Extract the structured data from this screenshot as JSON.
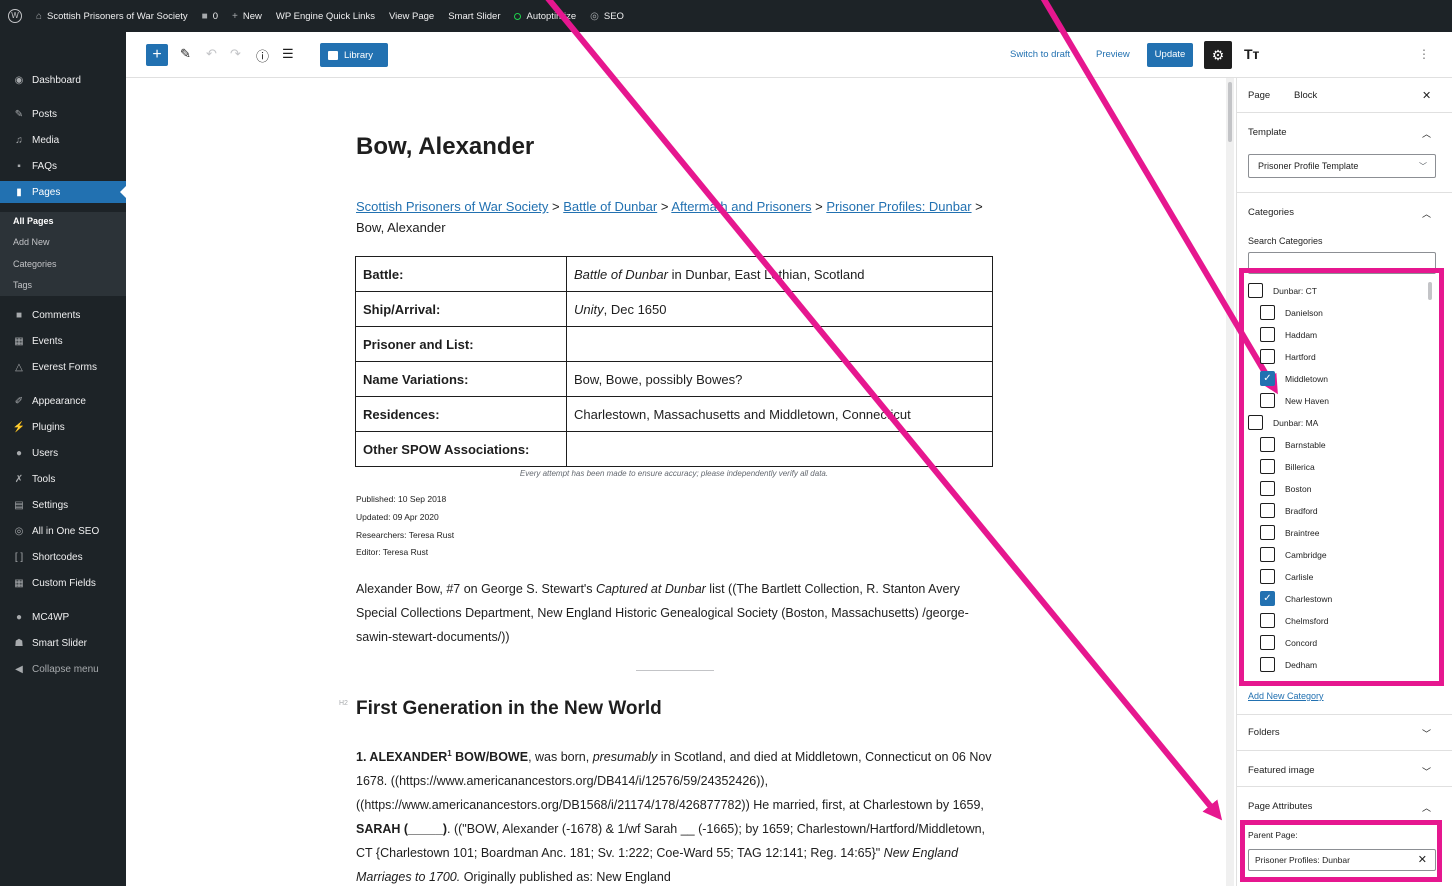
{
  "admin_bar": {
    "site_name": "Scottish Prisoners of War Society",
    "comments_count": "0",
    "new_label": "New",
    "quick_links": "WP Engine Quick Links",
    "view_page": "View Page",
    "smart_slider": "Smart Slider",
    "autoptimize": "Autoptimize",
    "seo": "SEO"
  },
  "sidebar": {
    "items": [
      {
        "label": "Dashboard",
        "icon": "dashboard-icon"
      },
      {
        "label": "Posts",
        "icon": "pin-icon"
      },
      {
        "label": "Media",
        "icon": "media-icon"
      },
      {
        "label": "FAQs",
        "icon": "faq-icon"
      },
      {
        "label": "Pages",
        "icon": "pages-icon"
      },
      {
        "label": "Comments",
        "icon": "comment-icon"
      },
      {
        "label": "Events",
        "icon": "calendar-icon"
      },
      {
        "label": "Everest Forms",
        "icon": "forms-icon"
      },
      {
        "label": "Appearance",
        "icon": "brush-icon"
      },
      {
        "label": "Plugins",
        "icon": "plugin-icon"
      },
      {
        "label": "Users",
        "icon": "users-icon"
      },
      {
        "label": "Tools",
        "icon": "wrench-icon"
      },
      {
        "label": "Settings",
        "icon": "settings-icon"
      },
      {
        "label": "All in One SEO",
        "icon": "seo-icon"
      },
      {
        "label": "Shortcodes",
        "icon": "brackets-icon"
      },
      {
        "label": "Custom Fields",
        "icon": "grid-icon"
      },
      {
        "label": "MC4WP",
        "icon": "mail-icon"
      },
      {
        "label": "Smart Slider",
        "icon": "slider-icon"
      },
      {
        "label": "Collapse menu",
        "icon": "collapse-icon"
      }
    ],
    "submenu": [
      "All Pages",
      "Add New",
      "Categories",
      "Tags"
    ]
  },
  "toolbar": {
    "library": "Library",
    "switch_to_draft": "Switch to draft",
    "preview": "Preview",
    "update": "Update"
  },
  "page": {
    "title": "Bow, Alexander",
    "breadcrumb": {
      "links": [
        "Scottish Prisoners of War Society",
        "Battle of Dunbar",
        "Aftermath and Prisoners",
        "Prisoner Profiles: Dunbar"
      ],
      "separator": " > ",
      "current": "Bow, Alexander"
    },
    "table": [
      {
        "label": "Battle:",
        "value_em": "Battle of Dunbar",
        "value": " in Dunbar, East Lothian, Scotland"
      },
      {
        "label": "Ship/Arrival:",
        "value_em": "Unity",
        "value": ", Dec 1650"
      },
      {
        "label": "Prisoner and List:",
        "value_em": "",
        "value": ""
      },
      {
        "label": "Name Variations:",
        "value_em": "",
        "value": "Bow, Bowe, possibly Bowes?"
      },
      {
        "label": "Residences:",
        "value_em": "",
        "value": "Charlestown, Massachusetts and Middletown, Connecticut"
      },
      {
        "label": "Other SPOW Associations:",
        "value_em": "",
        "value": ""
      }
    ],
    "caption": "Every attempt has been made to ensure accuracy; please independently verify all data.",
    "published": "Published: 10 Sep 2018",
    "updated": "Updated: 09 Apr 2020",
    "researchers": "Researchers: Teresa Rust",
    "editor": "Editor: Teresa Rust",
    "intro": {
      "before": "Alexander Bow, #7 on George S. Stewart's ",
      "em": "Captured at Dunbar",
      "after": " list ((The Bartlett Collection, R. Stanton Avery Special Collections Department, New England Historic Genealogical Society (Boston, Massachusetts) /george-sawin-stewart-documents/))"
    },
    "h2_tag": "H2",
    "heading": "First Generation in the New World",
    "gen": {
      "name": "1. ALEXANDER",
      "sup": "1",
      "name2": " BOW/BOWE",
      "t1": ", was born, ",
      "em1": "presumably",
      "t2": " in Scotland, and died at Middletown, Connecticut on 06 Nov 1678.  ((https://www.americanancestors.org/DB414/i/12576/59/24352426)), ((https://www.americanancestors.org/DB1568/i/21174/178/426877782)) He married, first, at Charlestown by 1659, ",
      "name3": "SARAH (_____)",
      "t3": ". ((\"BOW, Alexander (-1678) & 1/wf Sarah __ (-1665); by 1659; Charlestown/Hartford/Middletown, CT {Charlestown 101; Boardman Anc. 181; Sv. 1:222; Coe-Ward 55; TAG 12:141; Reg. 14:65}\" ",
      "em2": "New England Marriages to 1700.",
      "t4": " Originally published as: New England"
    }
  },
  "panel": {
    "tab_page": "Page",
    "tab_block": "Block",
    "template_title": "Template",
    "template_value": "Prisoner Profile Template",
    "categories_title": "Categories",
    "search_label": "Search Categories",
    "categories": [
      {
        "label": "Dunbar: CT",
        "checked": false,
        "level": 0
      },
      {
        "label": "Danielson",
        "checked": false,
        "level": 1
      },
      {
        "label": "Haddam",
        "checked": false,
        "level": 1
      },
      {
        "label": "Hartford",
        "checked": false,
        "level": 1
      },
      {
        "label": "Middletown",
        "checked": true,
        "level": 1
      },
      {
        "label": "New Haven",
        "checked": false,
        "level": 1
      },
      {
        "label": "Dunbar: MA",
        "checked": false,
        "level": 0
      },
      {
        "label": "Barnstable",
        "checked": false,
        "level": 1
      },
      {
        "label": "Billerica",
        "checked": false,
        "level": 1
      },
      {
        "label": "Boston",
        "checked": false,
        "level": 1
      },
      {
        "label": "Bradford",
        "checked": false,
        "level": 1
      },
      {
        "label": "Braintree",
        "checked": false,
        "level": 1
      },
      {
        "label": "Cambridge",
        "checked": false,
        "level": 1
      },
      {
        "label": "Carlisle",
        "checked": false,
        "level": 1
      },
      {
        "label": "Charlestown",
        "checked": true,
        "level": 1
      },
      {
        "label": "Chelmsford",
        "checked": false,
        "level": 1
      },
      {
        "label": "Concord",
        "checked": false,
        "level": 1
      },
      {
        "label": "Dedham",
        "checked": false,
        "level": 1
      }
    ],
    "add_category": "Add New Category",
    "folders": "Folders",
    "featured_image": "Featured image",
    "page_attributes": "Page Attributes",
    "parent_label": "Parent Page:",
    "parent_value": "Prisoner Profiles: Dunbar"
  },
  "colors": {
    "admin_dark": "#1d2327",
    "accent": "#2271b1",
    "highlight": "#e6178f"
  }
}
